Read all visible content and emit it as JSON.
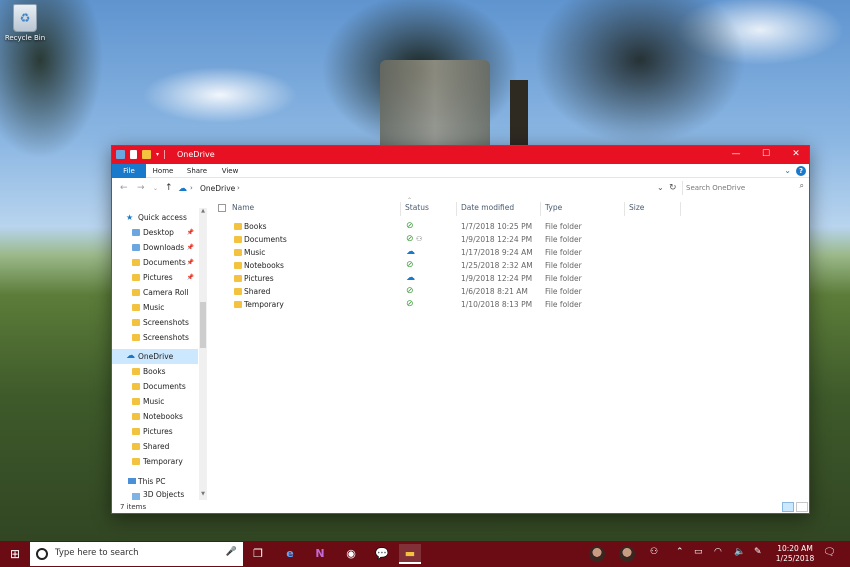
{
  "desktop": {
    "recycle_bin_label": "Recycle Bin"
  },
  "window": {
    "title": "OneDrive",
    "accent": "#e81123",
    "controls": {
      "minimize": "—",
      "maximize": "☐",
      "close": "✕"
    }
  },
  "ribbon": {
    "tabs": [
      "File",
      "Home",
      "Share",
      "View"
    ]
  },
  "navigation": {
    "path": "OneDrive",
    "path_separator": "›",
    "search_placeholder": "Search OneDrive"
  },
  "sidebar": {
    "quick_access": "Quick access",
    "quick_items": [
      "Desktop",
      "Downloads",
      "Documents",
      "Pictures",
      "Camera Roll",
      "Music",
      "Screenshots",
      "Screenshots"
    ],
    "onedrive": "OneDrive",
    "onedrive_items": [
      "Books",
      "Documents",
      "Music",
      "Notebooks",
      "Pictures",
      "Shared",
      "Temporary"
    ],
    "this_pc": "This PC",
    "pc_items": [
      "3D Objects"
    ]
  },
  "columns": {
    "name": "Name",
    "status": "Status",
    "date_modified": "Date modified",
    "type": "Type",
    "size": "Size"
  },
  "files": [
    {
      "name": "Books",
      "status": "synced",
      "date": "1/7/2018 10:25 PM",
      "type": "File folder"
    },
    {
      "name": "Documents",
      "status": "synced-shared",
      "date": "1/9/2018 12:24 PM",
      "type": "File folder"
    },
    {
      "name": "Music",
      "status": "cloud",
      "date": "1/17/2018 9:24 AM",
      "type": "File folder"
    },
    {
      "name": "Notebooks",
      "status": "synced",
      "date": "1/25/2018 2:32 AM",
      "type": "File folder"
    },
    {
      "name": "Pictures",
      "status": "cloud",
      "date": "1/9/2018 12:24 PM",
      "type": "File folder"
    },
    {
      "name": "Shared",
      "status": "synced",
      "date": "1/6/2018 8:21 AM",
      "type": "File folder"
    },
    {
      "name": "Temporary",
      "status": "synced",
      "date": "1/10/2018 8:13 PM",
      "type": "File folder"
    }
  ],
  "statusbar": {
    "item_count": "7 items"
  },
  "taskbar": {
    "search_placeholder": "Type here to search",
    "time": "10:20 AM",
    "date": "1/25/2018"
  }
}
